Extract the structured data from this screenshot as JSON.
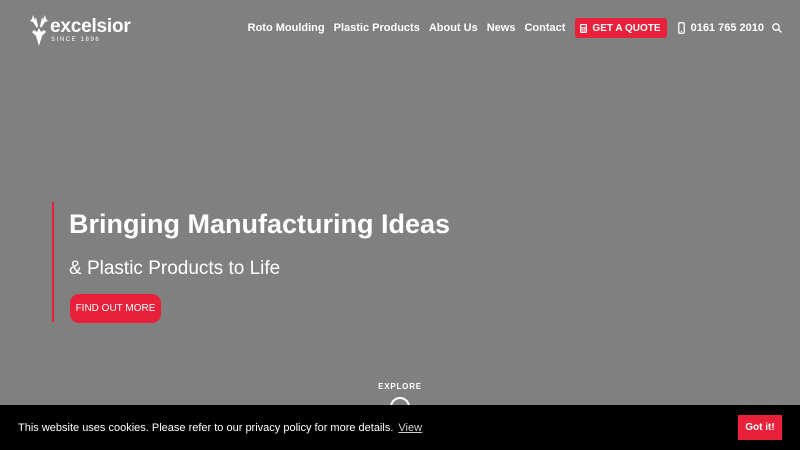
{
  "logo": {
    "word": "excelsior",
    "since": "SINCE 1896"
  },
  "nav": {
    "links": [
      "Roto Moulding",
      "Plastic Products",
      "About Us",
      "News",
      "Contact"
    ],
    "quote_label": "GET A QUOTE",
    "phone": "0161 765 2010"
  },
  "hero": {
    "title": "Bringing Manufacturing Ideas",
    "subtitle": "& Plastic Products to Life",
    "button": "FIND OUT MORE"
  },
  "explore": {
    "label": "EXPLORE"
  },
  "cookie": {
    "text": "This website uses cookies. Please refer to our privacy policy for more details.",
    "link": "View",
    "button": "Got it!"
  },
  "colors": {
    "accent": "#e8203a",
    "background": "#808080",
    "cookie_bar": "#000000"
  },
  "icons": [
    "stag-logo-icon",
    "calculator-icon",
    "mobile-phone-icon",
    "search-icon",
    "scroll-down-icon"
  ]
}
